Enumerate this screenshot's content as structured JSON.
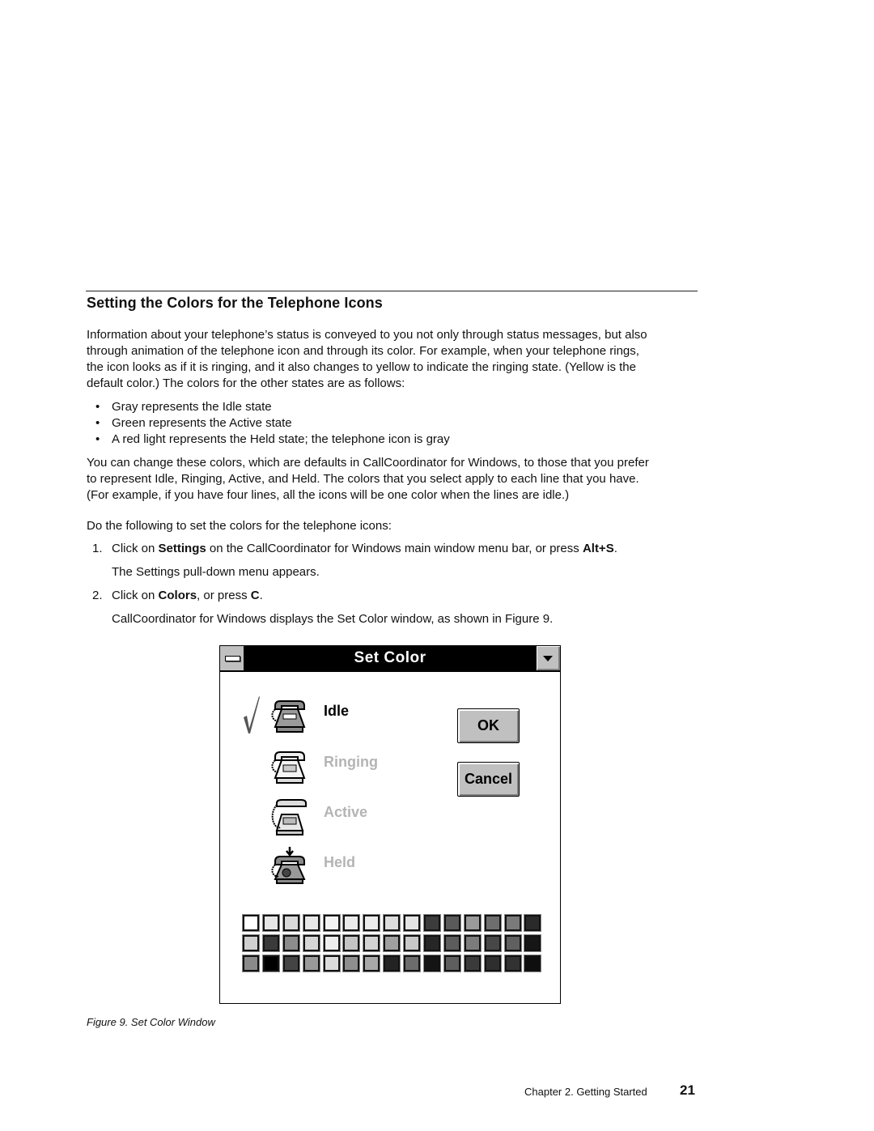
{
  "section": {
    "heading": "Setting the Colors for the Telephone Icons",
    "intro": [
      "Information about your telephone’s status is conveyed to you not only through status messages, but also",
      "through animation of the telephone icon and through its color.  For example, when your telephone rings,",
      "the icon looks as if it is ringing, and it also changes to yellow to indicate the ringing state.  (Yellow is the",
      "default color.)  The colors for the other states are as follows:"
    ],
    "bullets": [
      "Gray represents the Idle state",
      "Green represents the Active state",
      "A red light represents the Held state; the telephone icon is gray"
    ],
    "change_para": [
      "You can change these colors, which are defaults in CallCoordinator for Windows, to those that you prefer",
      "to represent Idle, Ringing, Active, and Held.  The colors that you select apply to each line that you have.",
      "(For example, if you have four lines, all the icons will be one color when the lines are idle.)"
    ],
    "do_following": "Do the following to set the colors for the telephone icons:",
    "steps": [
      {
        "num": "1.",
        "pre": "Click on ",
        "bold1": "Settings",
        "mid": " on the CallCoordinator for Windows main window menu bar, or press ",
        "bold2": "Alt+S",
        "post": ".",
        "result": "The Settings pull-down menu appears."
      },
      {
        "num": "2.",
        "pre": "Click on ",
        "bold1": "Colors",
        "mid": ", or press ",
        "bold2": "C",
        "post": ".",
        "result": "CallCoordinator for Windows displays the Set Color window, as shown in Figure  9."
      }
    ]
  },
  "dialog": {
    "title": "Set Color",
    "states": [
      {
        "label": "Idle",
        "selected": true
      },
      {
        "label": "Ringing",
        "selected": false
      },
      {
        "label": "Active",
        "selected": false
      },
      {
        "label": "Held",
        "selected": false
      }
    ],
    "ok_label": "OK",
    "cancel_label": "Cancel",
    "palette": [
      [
        "#ffffff",
        "#e6e6e6",
        "#d8d8d8",
        "#e8e8e8",
        "#f2f2f2",
        "#eaeaea",
        "#ececec",
        "#dcdcdc",
        "#e4e4e4",
        "#3c3c3c",
        "#5a5a5a",
        "#9a9a9a",
        "#6e6e6e",
        "#7a7a7a",
        "#2a2a2a"
      ],
      [
        "#d0d0d0",
        "#3a3a3a",
        "#8c8c8c",
        "#d6d6d6",
        "#eeeeee",
        "#c4c4c4",
        "#d4d4d4",
        "#a0a0a0",
        "#c8c8c8",
        "#262626",
        "#5c5c5c",
        "#7c7c7c",
        "#474747",
        "#606060",
        "#161616"
      ],
      [
        "#8a8a8a",
        "#000000",
        "#444444",
        "#9a9a9a",
        "#dcdcdc",
        "#8e8e8e",
        "#a8a8a8",
        "#232323",
        "#6c6c6c",
        "#141414",
        "#5e5e5e",
        "#3a3a3a",
        "#2e2e2e",
        "#323232",
        "#0e0e0e"
      ]
    ]
  },
  "caption": "Figure  9.  Set Color Window",
  "footer": {
    "chapter": "Chapter 2.  Getting Started",
    "page": "21"
  }
}
